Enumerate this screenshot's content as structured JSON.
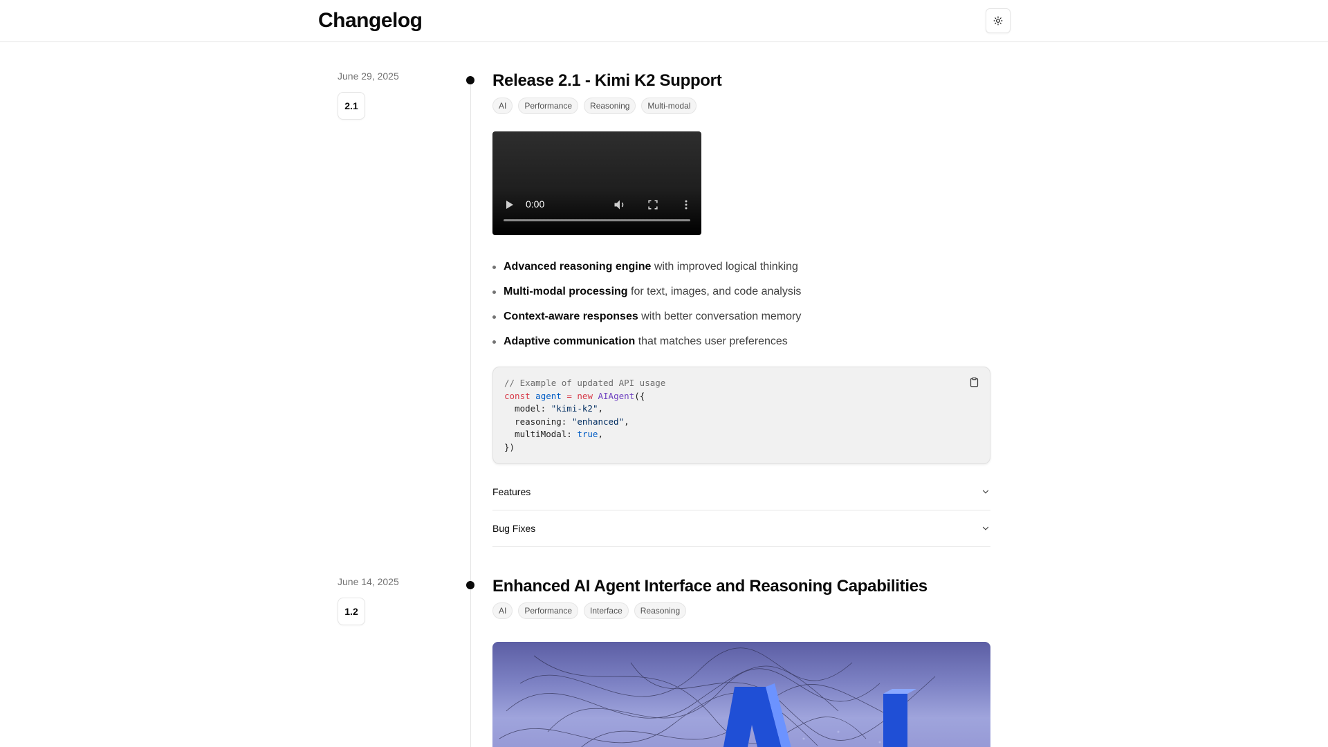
{
  "header": {
    "title": "Changelog",
    "theme_toggle_icon": "sun-icon"
  },
  "entries": [
    {
      "date": "June 29, 2025",
      "version": "2.1",
      "title": "Release 2.1 - Kimi K2 Support",
      "tags": [
        "AI",
        "Performance",
        "Reasoning",
        "Multi-modal"
      ],
      "video": {
        "time": "0:00"
      },
      "bullets": [
        {
          "bold": "Advanced reasoning engine",
          "rest": " with improved logical thinking"
        },
        {
          "bold": "Multi-modal processing",
          "rest": " for text, images, and code analysis"
        },
        {
          "bold": "Context-aware responses",
          "rest": " with better conversation memory"
        },
        {
          "bold": "Adaptive communication",
          "rest": " that matches user preferences"
        }
      ],
      "code": {
        "comment": "// Example of updated API usage",
        "kw_const": "const",
        "var_agent": "agent",
        "op_eq": " = ",
        "kw_new": "new",
        "fn_name": "AIAgent",
        "open": "({",
        "model_key": "  model: ",
        "model_val": "\"kimi-k2\"",
        "reasoning_key": "  reasoning: ",
        "reasoning_val": "\"enhanced\"",
        "multimodal_key": "  multiModal: ",
        "multimodal_val": "true",
        "comma": ",",
        "close": "})"
      },
      "accordions": [
        "Features",
        "Bug Fixes"
      ]
    },
    {
      "date": "June 14, 2025",
      "version": "1.2",
      "title": "Enhanced AI Agent Interface and Reasoning Capabilities",
      "tags": [
        "AI",
        "Performance",
        "Interface",
        "Reasoning"
      ]
    }
  ],
  "colors": {
    "accent_dark": "#0a0a0a",
    "border": "#e5e5e5",
    "muted_text": "#737373",
    "code_bg": "#f1f1f1"
  }
}
